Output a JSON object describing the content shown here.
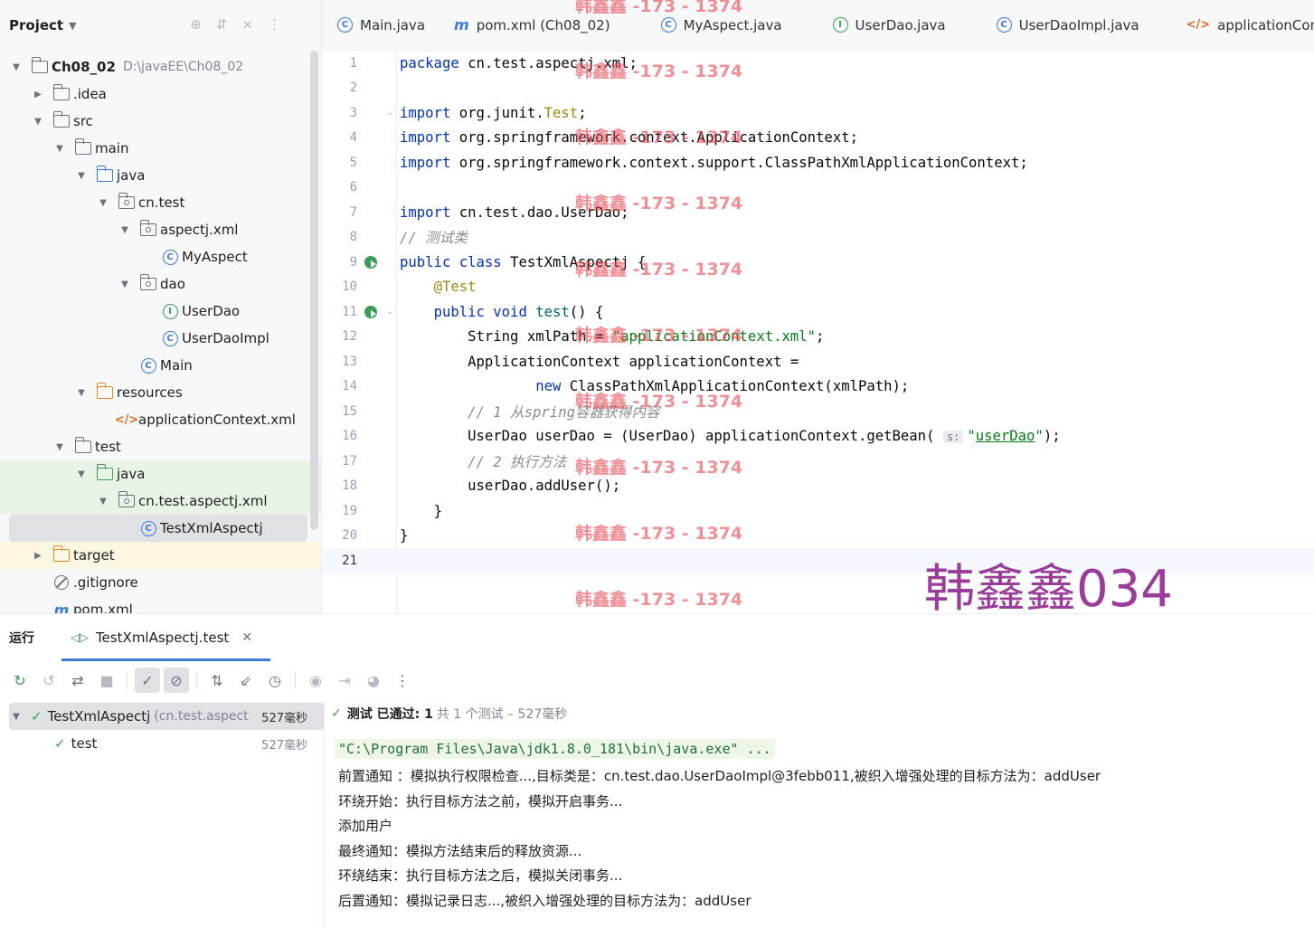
{
  "project": {
    "title": "Project",
    "tree": [
      {
        "label": "Ch08_02",
        "extra": "D:\\javaEE\\Ch08_02"
      },
      {
        "label": ".idea"
      },
      {
        "label": "src"
      },
      {
        "label": "main"
      },
      {
        "label": "java"
      },
      {
        "label": "cn.test"
      },
      {
        "label": "aspectj.xml"
      },
      {
        "label": "MyAspect"
      },
      {
        "label": "dao"
      },
      {
        "label": "UserDao"
      },
      {
        "label": "UserDaoImpl"
      },
      {
        "label": "Main"
      },
      {
        "label": "resources"
      },
      {
        "label": "applicationContext.xml"
      },
      {
        "label": "test"
      },
      {
        "label": "java"
      },
      {
        "label": "cn.test.aspectj.xml"
      },
      {
        "label": "TestXmlAspectj"
      },
      {
        "label": "target"
      },
      {
        "label": ".gitignore"
      },
      {
        "label": "pom.xml"
      }
    ]
  },
  "editor": {
    "tabs": [
      "Main.java",
      "pom.xml (Ch08_02)",
      "MyAspect.java",
      "UserDao.java",
      "UserDaoImpl.java",
      "applicationConte"
    ],
    "lines": [
      "1",
      "2",
      "3",
      "4",
      "5",
      "6",
      "7",
      "8",
      "9",
      "10",
      "11",
      "12",
      "13",
      "14",
      "15",
      "16",
      "17",
      "18",
      "19",
      "20",
      "21"
    ],
    "code": {
      "l1_kw": "package",
      "l1_rest": " cn.test.aspectj.xml;",
      "l3_kw": "import",
      "l3_mid": " org.junit.",
      "l3_ann": "Test",
      "l3_end": ";",
      "l4_kw": "import",
      "l4_rest": " org.springframework.context.ApplicationContext;",
      "l5_kw": "import",
      "l5_rest": " org.springframework.context.support.ClassPathXmlApplicationContext;",
      "l7_kw": "import",
      "l7_rest": " cn.test.dao.UserDao;",
      "l8_cmt": "// 测试类",
      "l9_kw": "public class",
      "l9_rest": " TestXmlAspectj {",
      "l10_ann": "@Test",
      "l11_kw": "public void",
      "l11_fn": " test",
      "l11_rest": "() {",
      "l12_a": "String xmlPath = ",
      "l12_str": "\"applicationContext.xml\"",
      "l12_end": ";",
      "l13": "ApplicationContext applicationContext =",
      "l14_kw": "new",
      "l14_rest": " ClassPathXmlApplicationContext(xmlPath);",
      "l15_cmt": "// 1 从spring容器获得内容",
      "l16_a": "UserDao userDao = (UserDao) applicationContext.getBean(",
      "l16_hint": "s:",
      "l16_q1": "\"",
      "l16_str": "userDao",
      "l16_q2": "\"",
      "l16_end": ");",
      "l17_cmt": "// 2 执行方法",
      "l18": "userDao.addUser();",
      "l19": "}",
      "l20": "}"
    },
    "watermark": "韩鑫鑫 -173 - 1374",
    "author_mark": "韩鑫鑫034"
  },
  "run": {
    "title": "运行",
    "tab_label": "TestXmlAspectj.test",
    "tests": [
      {
        "name": "TestXmlAspectj",
        "detail": "(cn.test.aspect",
        "time": "527毫秒"
      },
      {
        "name": "test",
        "time": "527毫秒"
      }
    ],
    "status_pass": "测试 已通过: 1",
    "status_sum": "共 1 个测试 – 527毫秒",
    "output": [
      "\"C:\\Program Files\\Java\\jdk1.8.0_181\\bin\\java.exe\" ...",
      "前置通知 ：模拟执行权限检查...,目标类是：cn.test.dao.UserDaoImpl@3febb011,被织入增强处理的目标方法为：addUser",
      "环绕开始：执行目标方法之前，模拟开启事务...",
      "添加用户",
      "最终通知：模拟方法结束后的释放资源...",
      "环绕结束：执行目标方法之后，模拟关闭事务...",
      "后置通知：模拟记录日志...,被织入增强处理的目标方法为：addUser"
    ]
  }
}
